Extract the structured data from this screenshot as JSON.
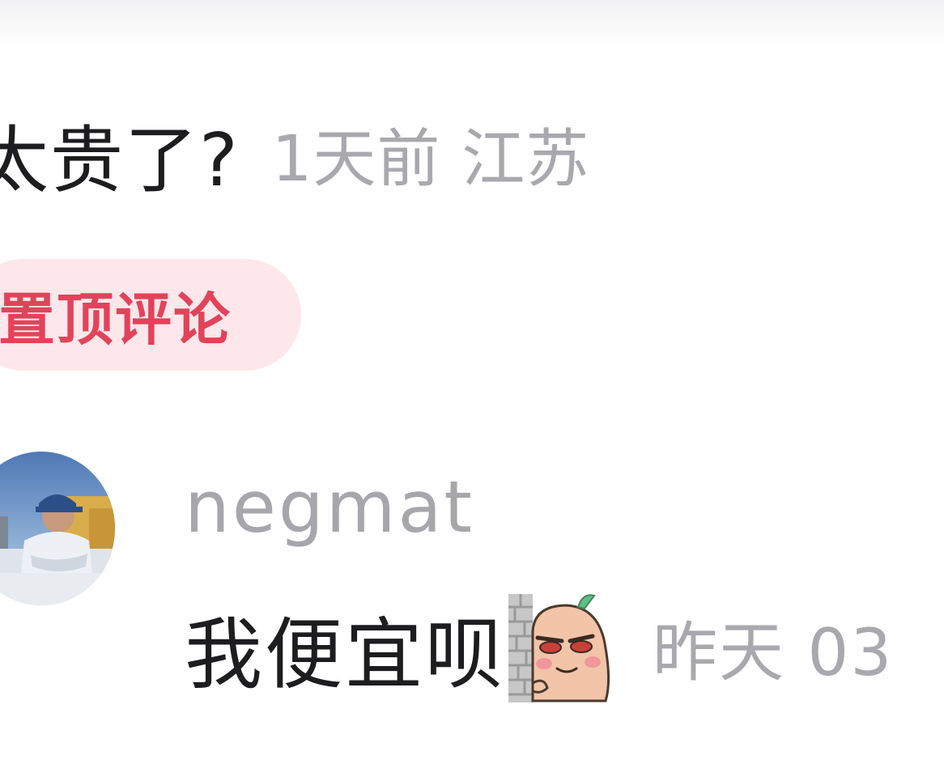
{
  "previous_comment": {
    "text": "太贵了?",
    "time": "1天前",
    "location": "江苏"
  },
  "pin_badge": {
    "label": "置顶评论",
    "color": "#e2435a",
    "background": "#fde7ea"
  },
  "reply": {
    "username": "negmat",
    "text": "我便宜呗",
    "sticker_icon": "peeking-peanut-sticker",
    "time": "昨天 03"
  }
}
